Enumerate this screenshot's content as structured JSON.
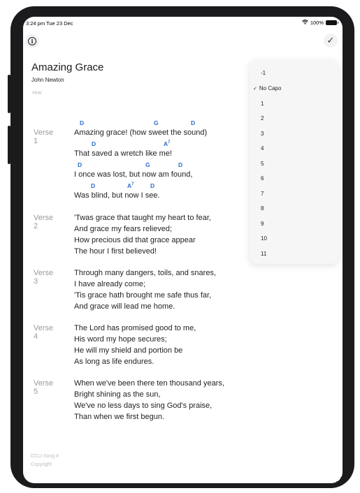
{
  "status_bar": {
    "time": "3:24 pm  Tue 23 Dec",
    "battery": "100%"
  },
  "song": {
    "title": "Amazing Grace",
    "author": "John Newton",
    "year": "Year"
  },
  "verses": [
    {
      "label": "Verse 1",
      "lines": [
        "Amazing grace! (how sweet the sound)",
        "That saved a wretch like me!",
        "I once was lost, but now am found,",
        "Was blind, but now I see."
      ],
      "chords": [
        {
          "line": 0,
          "chords": [
            "D",
            "G",
            "D"
          ]
        },
        {
          "line": 1,
          "chords": [
            "D",
            "A",
            "7"
          ]
        },
        {
          "line": 2,
          "chords": [
            "D",
            "G",
            "D"
          ]
        },
        {
          "line": 3,
          "chords": [
            "D",
            "A",
            "7",
            "D"
          ]
        }
      ]
    },
    {
      "label": "Verse 2",
      "lines": [
        "'Twas grace that taught my heart to fear,",
        "And grace my fears relieved;",
        "How precious did that grace appear",
        "The hour I first believed!"
      ]
    },
    {
      "label": "Verse 3",
      "lines": [
        "Through many dangers, toils, and snares,",
        "I have already come;",
        "'Tis grace hath brought me safe thus far,",
        "And grace will lead me home."
      ]
    },
    {
      "label": "Verse 4",
      "lines": [
        "The Lord has promised good to me,",
        "His word my hope secures;",
        "He will my shield and portion be",
        "As long as life endures."
      ]
    },
    {
      "label": "Verse 5",
      "lines": [
        "When we've been there ten thousand years,",
        "Bright shining as the sun,",
        "We've no less days to sing God's praise,",
        "Than when we first begun."
      ]
    }
  ],
  "footer": {
    "ccli": "CCLI Song #",
    "copyright": "Copyright"
  },
  "capo_menu": {
    "items": [
      "-1",
      "No Capo",
      "1",
      "2",
      "3",
      "4",
      "5",
      "6",
      "7",
      "8",
      "9",
      "10",
      "11"
    ],
    "selected": "No Capo",
    "check": "✓"
  },
  "icons": {
    "info": "i",
    "done": "✓",
    "wifi": "wifi-icon"
  }
}
